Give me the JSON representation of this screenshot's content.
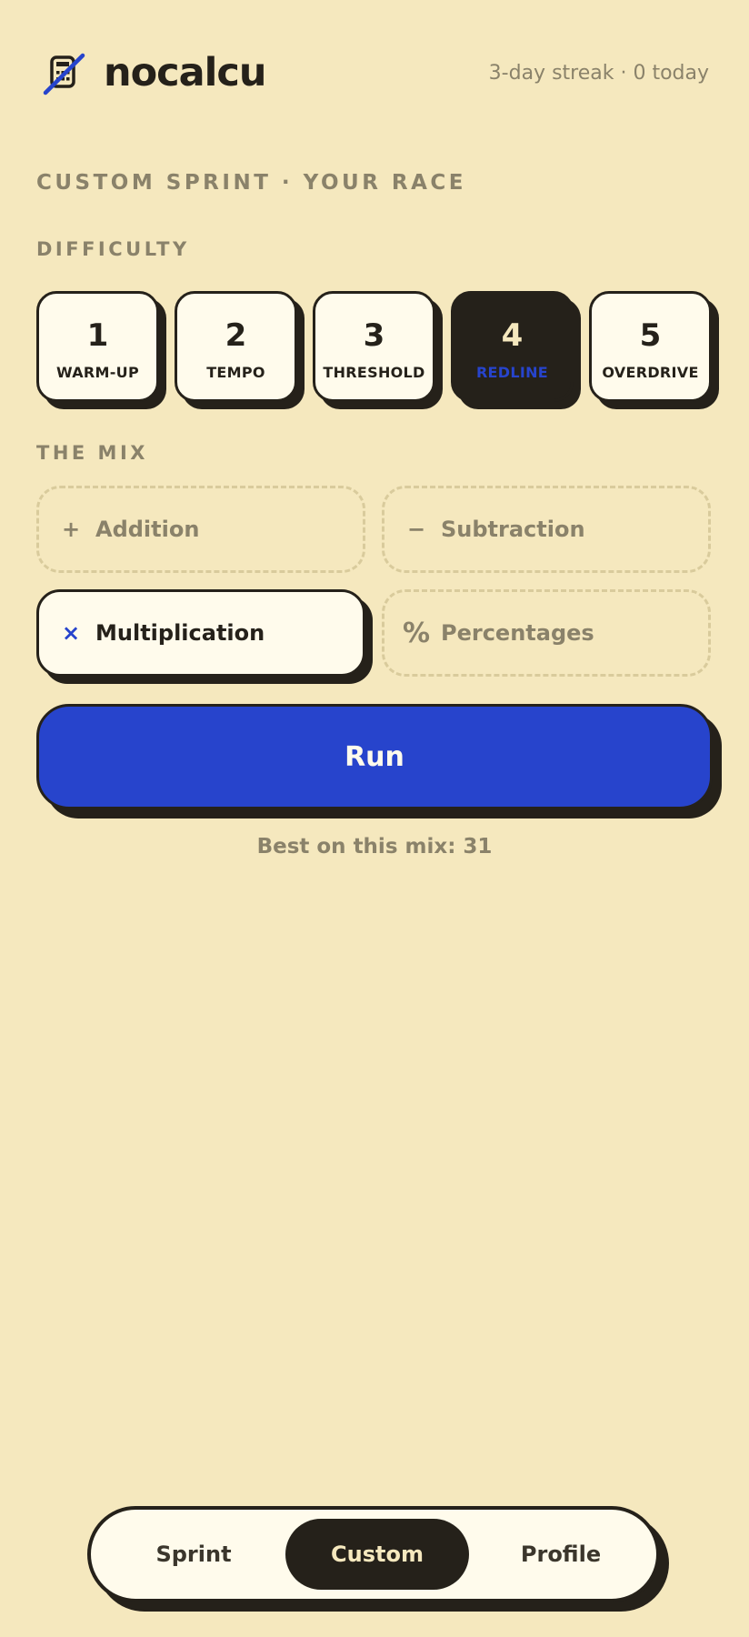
{
  "app": {
    "brand": "nocalcu",
    "streak": "3-day streak · 0 today"
  },
  "section_title": "CUSTOM SPRINT · YOUR RACE",
  "difficulty": {
    "label": "DIFFICULTY",
    "selected": "4",
    "levels": [
      {
        "num": "1",
        "name": "WARM-UP"
      },
      {
        "num": "2",
        "name": "TEMPO"
      },
      {
        "num": "3",
        "name": "THRESHOLD"
      },
      {
        "num": "4",
        "name": "REDLINE"
      },
      {
        "num": "5",
        "name": "OVERDRIVE"
      }
    ]
  },
  "mix": {
    "label": "THE MIX",
    "options": [
      {
        "symbol": "+",
        "label": "Addition",
        "selected": false
      },
      {
        "symbol": "−",
        "label": "Subtraction",
        "selected": false
      },
      {
        "symbol": "×",
        "label": "Multiplication",
        "selected": true
      },
      {
        "symbol": "%",
        "label": "Percentages",
        "selected": false
      }
    ]
  },
  "run": {
    "label": "Run"
  },
  "best": "Best on this mix: 31",
  "nav": {
    "active": "Custom",
    "items": [
      {
        "label": "Sprint"
      },
      {
        "label": "Custom"
      },
      {
        "label": "Profile"
      }
    ]
  },
  "colors": {
    "background": "#F5E8BE",
    "ink": "#25211A",
    "accent": "#2744CC",
    "card": "#FFFBEC",
    "muted": "#8A826A"
  }
}
